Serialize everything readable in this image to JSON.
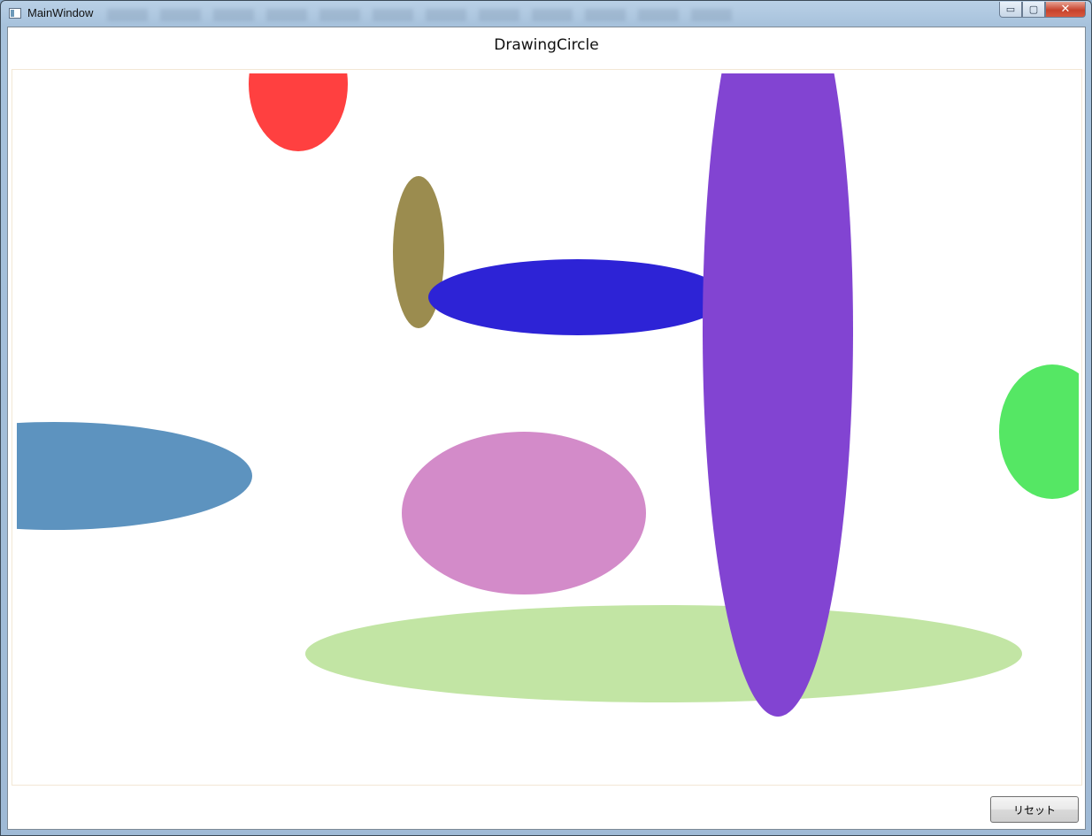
{
  "window": {
    "title": "MainWindow",
    "caption_buttons": {
      "minimize": "▭",
      "maximize": "▢",
      "close": "✕"
    }
  },
  "header": {
    "title": "DrawingCircle"
  },
  "buttons": {
    "reset_label": "リセット"
  },
  "colors": {
    "red": "#ff4040",
    "olive": "#9b8c4f",
    "blue": "#2d23d6",
    "purple": "#8244d2",
    "green": "#55e764",
    "steelblue": "#5d93bf",
    "pink": "#d38bc9",
    "lightgreen": "#c2e5a4"
  }
}
